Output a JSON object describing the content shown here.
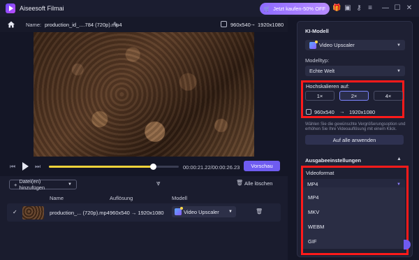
{
  "app": {
    "title": "Aiseesoft Filmai",
    "buy_label": "Jetzt kaufen-50% OFF",
    "accent": "#6f5cf0"
  },
  "header": {
    "name_label": "Name:",
    "file_name": "production_id_....784 (720p).mp4",
    "res_from": "960x540",
    "res_to": "1920x1080"
  },
  "player": {
    "current_time": "00:00:21.22/00:00:26.23",
    "preview_label": "Vorschau",
    "progress": 0.8
  },
  "files": {
    "add_label": "Datei(en) hinzufügen",
    "clear_label": "Alle löschen",
    "columns": {
      "name": "Name",
      "resolution": "Auflösung",
      "model": "Modell"
    },
    "rows": [
      {
        "name": "production_... (720p).mp4",
        "res_from": "960x540",
        "res_to": "1920x1080",
        "model": "Video Upscaler"
      }
    ]
  },
  "panel": {
    "ki_title": "KI-Modell",
    "ki_model": "Video Upscaler",
    "modeltyp_label": "Modelltyp:",
    "modeltyp_value": "Echte Welt",
    "scale_label": "Hochskalieren auf:",
    "scale_options": [
      "1×",
      "2×",
      "4×"
    ],
    "scale_selected": "2×",
    "scale_res_from": "960x540",
    "scale_res_to": "1920x1080",
    "hint": "Wählen Sie die gewünschte Vergrößerungsoption und erhöhen Sie Ihre Videoauflösung mit einem Klick.",
    "apply_all_label": "Auf alle anwenden",
    "output_title": "Ausgabeeinstellungen",
    "format_label": "Videoformat",
    "format_value": "MP4",
    "format_options": [
      "MP4",
      "MKV",
      "WEBM",
      "GIF"
    ]
  }
}
